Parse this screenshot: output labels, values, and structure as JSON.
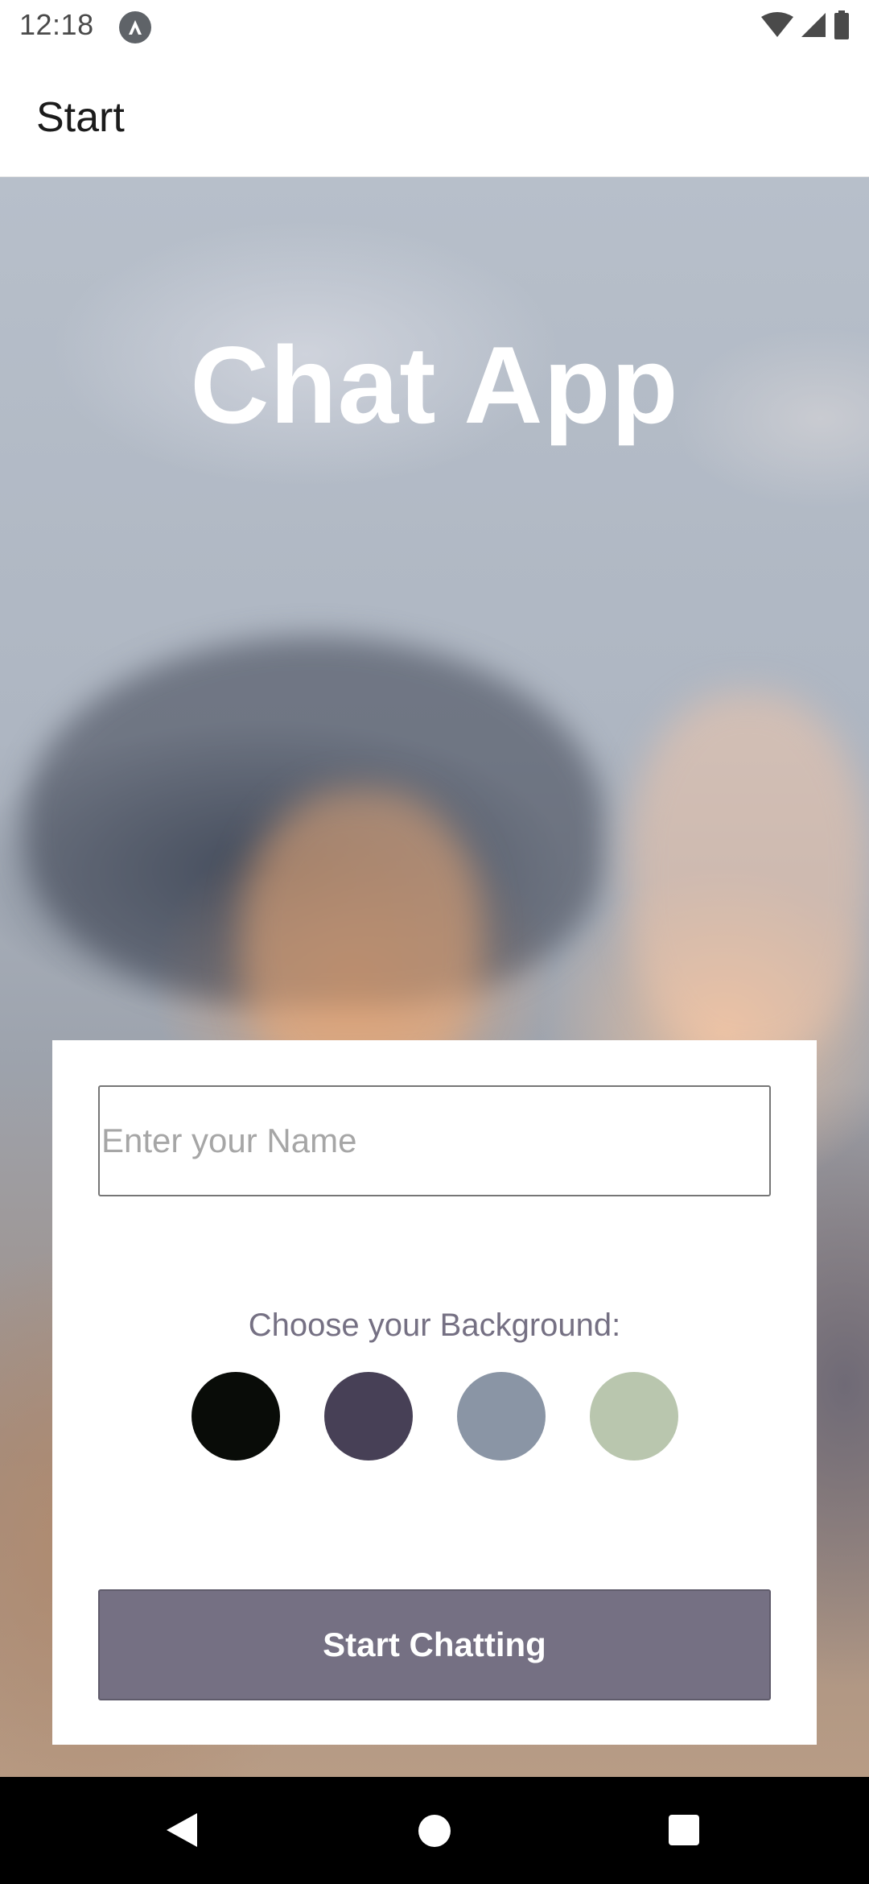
{
  "status_bar": {
    "time": "12:18",
    "icons": [
      "app-notification-icon",
      "wifi-icon",
      "signal-icon",
      "battery-icon"
    ]
  },
  "app_bar": {
    "title": "Start"
  },
  "hero": {
    "title": "Chat App"
  },
  "form": {
    "name_input": {
      "value": "",
      "placeholder": "Enter your Name"
    },
    "background_label": "Choose your Background:",
    "background_options": [
      {
        "color": "#090C08"
      },
      {
        "color": "#474056"
      },
      {
        "color": "#8A95A5"
      },
      {
        "color": "#B9C6AE"
      }
    ],
    "start_button_label": "Start Chatting"
  },
  "colors": {
    "button": "#757083",
    "label_text": "#757083",
    "hero_text": "#FFFFFF"
  },
  "nav_bar": {
    "icons": [
      "back-icon",
      "home-icon",
      "recents-icon"
    ]
  }
}
